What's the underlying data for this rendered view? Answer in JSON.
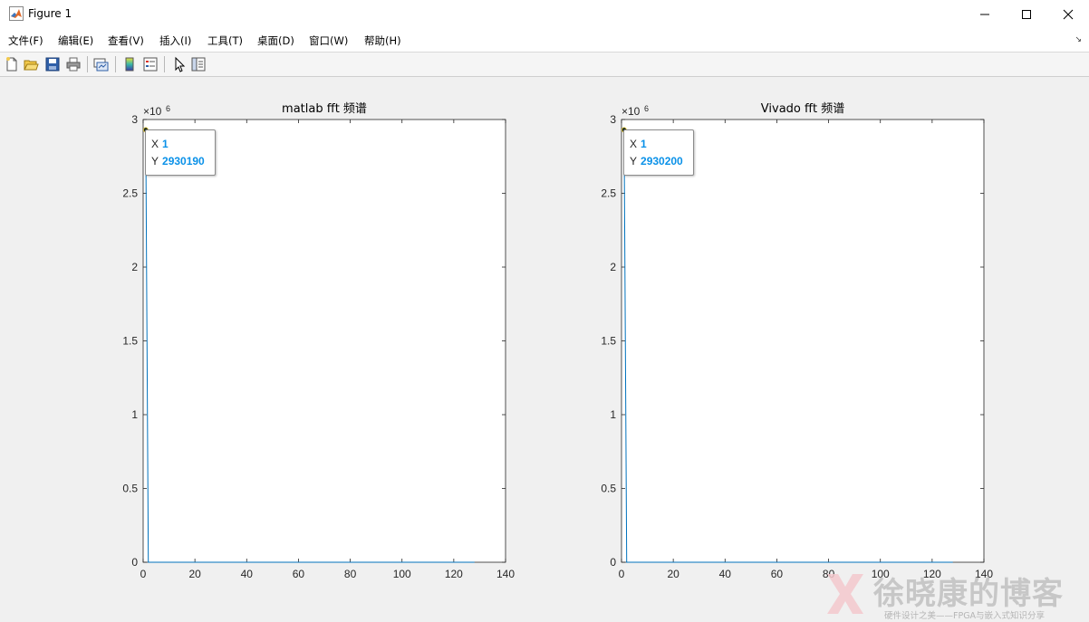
{
  "window": {
    "title": "Figure 1"
  },
  "menu": [
    "文件(F)",
    "编辑(E)",
    "查看(V)",
    "插入(I)",
    "工具(T)",
    "桌面(D)",
    "窗口(W)",
    "帮助(H)"
  ],
  "toolbar_icons": [
    "new-figure-icon",
    "open-file-icon",
    "save-icon",
    "print-icon",
    "link-plot-icon",
    "colorbar-icon",
    "legend-icon",
    "pointer-icon",
    "property-editor-icon"
  ],
  "colors": {
    "line": "#0072bd",
    "datatip_value": "#0a91e8",
    "axes": "#262626"
  },
  "chart_data": [
    {
      "type": "line",
      "title": "matlab fft 频谱",
      "exponent_label": "×10",
      "exponent_power": "6",
      "xlim": [
        0,
        140
      ],
      "ylim": [
        0,
        3000000
      ],
      "xticks": [
        "0",
        "20",
        "40",
        "60",
        "80",
        "100",
        "120",
        "140"
      ],
      "yticks": [
        "0",
        "0.5",
        "1",
        "1.5",
        "2",
        "2.5",
        "3"
      ],
      "x": [
        1,
        2,
        3,
        128
      ],
      "y": [
        2930190,
        0,
        0,
        0
      ],
      "datatip": {
        "x_label": "X",
        "x_value": "1",
        "y_label": "Y",
        "y_value": "2930190"
      }
    },
    {
      "type": "line",
      "title": "Vivado fft 频谱",
      "exponent_label": "×10",
      "exponent_power": "6",
      "xlim": [
        0,
        140
      ],
      "ylim": [
        0,
        3000000
      ],
      "xticks": [
        "0",
        "20",
        "40",
        "60",
        "80",
        "100",
        "120",
        "140"
      ],
      "yticks": [
        "0",
        "0.5",
        "1",
        "1.5",
        "2",
        "2.5",
        "3"
      ],
      "x": [
        1,
        2,
        3,
        128
      ],
      "y": [
        2930200,
        0,
        0,
        0
      ],
      "datatip": {
        "x_label": "X",
        "x_value": "1",
        "y_label": "Y",
        "y_value": "2930200"
      }
    }
  ],
  "watermark": {
    "main": "徐晓康的博客",
    "sub": "硬件设计之美——FPGA与嵌入式知识分享"
  }
}
